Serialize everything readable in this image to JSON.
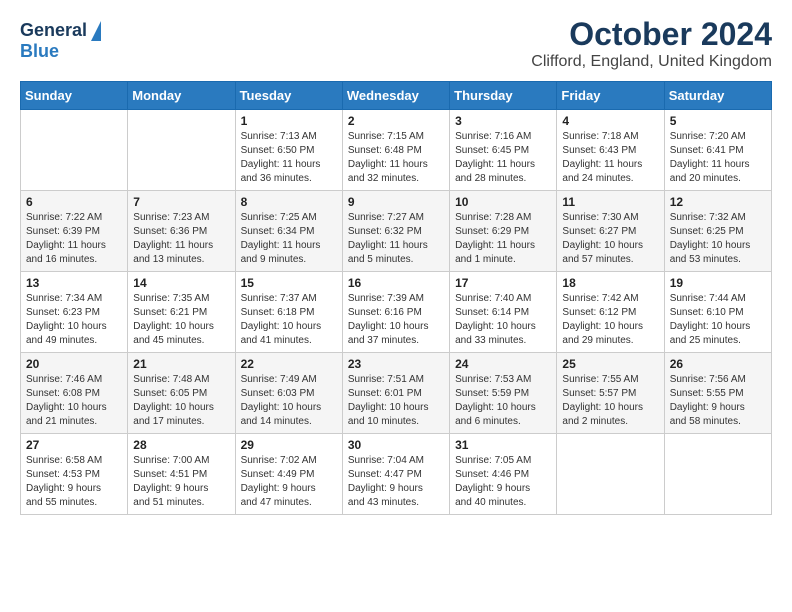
{
  "header": {
    "logo_general": "General",
    "logo_blue": "Blue",
    "month": "October 2024",
    "location": "Clifford, England, United Kingdom"
  },
  "weekdays": [
    "Sunday",
    "Monday",
    "Tuesday",
    "Wednesday",
    "Thursday",
    "Friday",
    "Saturday"
  ],
  "weeks": [
    [
      {
        "day": "",
        "info": ""
      },
      {
        "day": "",
        "info": ""
      },
      {
        "day": "1",
        "info": "Sunrise: 7:13 AM\nSunset: 6:50 PM\nDaylight: 11 hours\nand 36 minutes."
      },
      {
        "day": "2",
        "info": "Sunrise: 7:15 AM\nSunset: 6:48 PM\nDaylight: 11 hours\nand 32 minutes."
      },
      {
        "day": "3",
        "info": "Sunrise: 7:16 AM\nSunset: 6:45 PM\nDaylight: 11 hours\nand 28 minutes."
      },
      {
        "day": "4",
        "info": "Sunrise: 7:18 AM\nSunset: 6:43 PM\nDaylight: 11 hours\nand 24 minutes."
      },
      {
        "day": "5",
        "info": "Sunrise: 7:20 AM\nSunset: 6:41 PM\nDaylight: 11 hours\nand 20 minutes."
      }
    ],
    [
      {
        "day": "6",
        "info": "Sunrise: 7:22 AM\nSunset: 6:39 PM\nDaylight: 11 hours\nand 16 minutes."
      },
      {
        "day": "7",
        "info": "Sunrise: 7:23 AM\nSunset: 6:36 PM\nDaylight: 11 hours\nand 13 minutes."
      },
      {
        "day": "8",
        "info": "Sunrise: 7:25 AM\nSunset: 6:34 PM\nDaylight: 11 hours\nand 9 minutes."
      },
      {
        "day": "9",
        "info": "Sunrise: 7:27 AM\nSunset: 6:32 PM\nDaylight: 11 hours\nand 5 minutes."
      },
      {
        "day": "10",
        "info": "Sunrise: 7:28 AM\nSunset: 6:29 PM\nDaylight: 11 hours\nand 1 minute."
      },
      {
        "day": "11",
        "info": "Sunrise: 7:30 AM\nSunset: 6:27 PM\nDaylight: 10 hours\nand 57 minutes."
      },
      {
        "day": "12",
        "info": "Sunrise: 7:32 AM\nSunset: 6:25 PM\nDaylight: 10 hours\nand 53 minutes."
      }
    ],
    [
      {
        "day": "13",
        "info": "Sunrise: 7:34 AM\nSunset: 6:23 PM\nDaylight: 10 hours\nand 49 minutes."
      },
      {
        "day": "14",
        "info": "Sunrise: 7:35 AM\nSunset: 6:21 PM\nDaylight: 10 hours\nand 45 minutes."
      },
      {
        "day": "15",
        "info": "Sunrise: 7:37 AM\nSunset: 6:18 PM\nDaylight: 10 hours\nand 41 minutes."
      },
      {
        "day": "16",
        "info": "Sunrise: 7:39 AM\nSunset: 6:16 PM\nDaylight: 10 hours\nand 37 minutes."
      },
      {
        "day": "17",
        "info": "Sunrise: 7:40 AM\nSunset: 6:14 PM\nDaylight: 10 hours\nand 33 minutes."
      },
      {
        "day": "18",
        "info": "Sunrise: 7:42 AM\nSunset: 6:12 PM\nDaylight: 10 hours\nand 29 minutes."
      },
      {
        "day": "19",
        "info": "Sunrise: 7:44 AM\nSunset: 6:10 PM\nDaylight: 10 hours\nand 25 minutes."
      }
    ],
    [
      {
        "day": "20",
        "info": "Sunrise: 7:46 AM\nSunset: 6:08 PM\nDaylight: 10 hours\nand 21 minutes."
      },
      {
        "day": "21",
        "info": "Sunrise: 7:48 AM\nSunset: 6:05 PM\nDaylight: 10 hours\nand 17 minutes."
      },
      {
        "day": "22",
        "info": "Sunrise: 7:49 AM\nSunset: 6:03 PM\nDaylight: 10 hours\nand 14 minutes."
      },
      {
        "day": "23",
        "info": "Sunrise: 7:51 AM\nSunset: 6:01 PM\nDaylight: 10 hours\nand 10 minutes."
      },
      {
        "day": "24",
        "info": "Sunrise: 7:53 AM\nSunset: 5:59 PM\nDaylight: 10 hours\nand 6 minutes."
      },
      {
        "day": "25",
        "info": "Sunrise: 7:55 AM\nSunset: 5:57 PM\nDaylight: 10 hours\nand 2 minutes."
      },
      {
        "day": "26",
        "info": "Sunrise: 7:56 AM\nSunset: 5:55 PM\nDaylight: 9 hours\nand 58 minutes."
      }
    ],
    [
      {
        "day": "27",
        "info": "Sunrise: 6:58 AM\nSunset: 4:53 PM\nDaylight: 9 hours\nand 55 minutes."
      },
      {
        "day": "28",
        "info": "Sunrise: 7:00 AM\nSunset: 4:51 PM\nDaylight: 9 hours\nand 51 minutes."
      },
      {
        "day": "29",
        "info": "Sunrise: 7:02 AM\nSunset: 4:49 PM\nDaylight: 9 hours\nand 47 minutes."
      },
      {
        "day": "30",
        "info": "Sunrise: 7:04 AM\nSunset: 4:47 PM\nDaylight: 9 hours\nand 43 minutes."
      },
      {
        "day": "31",
        "info": "Sunrise: 7:05 AM\nSunset: 4:46 PM\nDaylight: 9 hours\nand 40 minutes."
      },
      {
        "day": "",
        "info": ""
      },
      {
        "day": "",
        "info": ""
      }
    ]
  ]
}
